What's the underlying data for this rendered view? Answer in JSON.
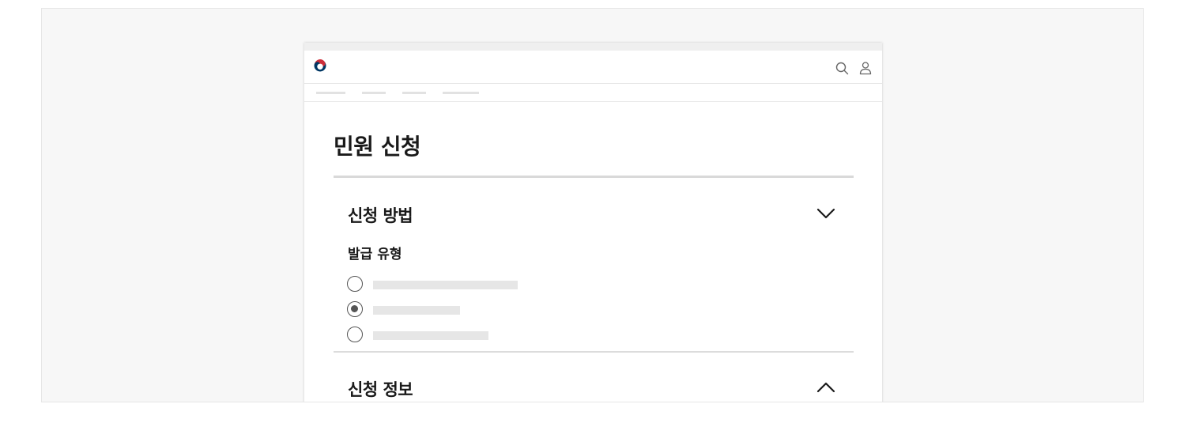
{
  "page": {
    "title": "민원 신청"
  },
  "header": {
    "logo_icon": "government-taegeuk-logo-icon",
    "search_icon": "search-icon",
    "user_icon": "user-icon"
  },
  "nav": {
    "item_count": 4
  },
  "sections": [
    {
      "title": "신청 방법",
      "expanded": true,
      "toggle_icon": "chevron-down-icon",
      "subsection": {
        "label": "발급 유형",
        "options": [
          {
            "selected": false
          },
          {
            "selected": true
          },
          {
            "selected": false
          }
        ]
      }
    },
    {
      "title": "신청 정보",
      "expanded": false,
      "toggle_icon": "chevron-up-icon"
    }
  ],
  "colors": {
    "background": "#f7f7f7",
    "text": "#1a1a1a",
    "placeholder": "#e6e6e6",
    "logo_red": "#cd2e3a",
    "logo_blue": "#0047a0",
    "logo_navy": "#003764"
  }
}
